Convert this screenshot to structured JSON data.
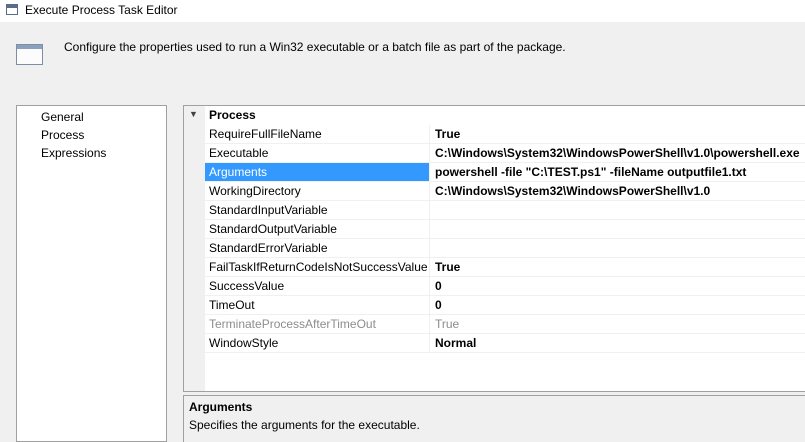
{
  "window": {
    "title": "Execute Process Task Editor"
  },
  "header": {
    "description": "Configure the properties used to run a Win32 executable or a batch file as part of the package."
  },
  "nav": {
    "items": [
      {
        "label": "General"
      },
      {
        "label": "Process"
      },
      {
        "label": "Expressions"
      }
    ]
  },
  "grid": {
    "category": "Process",
    "toggle_glyph": "▼",
    "properties": [
      {
        "name": "RequireFullFileName",
        "value": "True"
      },
      {
        "name": "Executable",
        "value": "C:\\Windows\\System32\\WindowsPowerShell\\v1.0\\powershell.exe"
      },
      {
        "name": "Arguments",
        "value": "powershell -file \"C:\\TEST.ps1\" -fileName outputfile1.txt"
      },
      {
        "name": "WorkingDirectory",
        "value": "C:\\Windows\\System32\\WindowsPowerShell\\v1.0"
      },
      {
        "name": "StandardInputVariable",
        "value": ""
      },
      {
        "name": "StandardOutputVariable",
        "value": ""
      },
      {
        "name": "StandardErrorVariable",
        "value": ""
      },
      {
        "name": "FailTaskIfReturnCodeIsNotSuccessValue",
        "value": "True"
      },
      {
        "name": "SuccessValue",
        "value": "0"
      },
      {
        "name": "TimeOut",
        "value": "0"
      },
      {
        "name": "TerminateProcessAfterTimeOut",
        "value": "True"
      },
      {
        "name": "WindowStyle",
        "value": "Normal"
      }
    ]
  },
  "help": {
    "title": "Arguments",
    "text": "Specifies the arguments for the executable."
  }
}
